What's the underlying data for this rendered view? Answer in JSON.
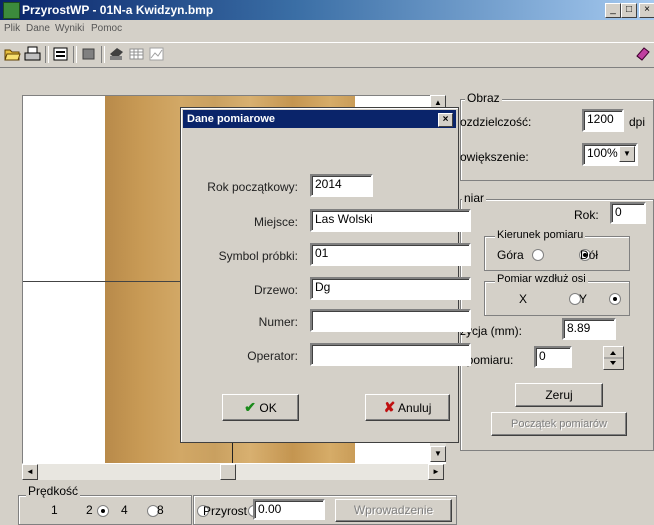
{
  "window": {
    "title": "PrzyrostWP - 01N-a Kwidzyn.bmp",
    "minimize": "_",
    "maximize": "□",
    "close": "×"
  },
  "menu": [
    "Plik",
    "Dane",
    "Wyniki",
    "Pomoc"
  ],
  "icons": [
    "open-folder-icon",
    "print-icon",
    "data-icon",
    "stop-icon",
    "printer-icon",
    "table-icon",
    "chart-icon",
    "eraser-icon"
  ],
  "image_panel": {
    "scroll_left": "◄",
    "scroll_right": "►",
    "scroll_up": "▲",
    "scroll_down": "▼"
  },
  "obraz": {
    "title": "Obraz",
    "resolution_label": "ozdzielczość:",
    "resolution_value": "1200",
    "resolution_unit": "dpi",
    "zoom_label": "owiększenie:",
    "zoom_value": "100%"
  },
  "pomiar": {
    "title": "niar",
    "year_label": "Rok:",
    "year_value": "0",
    "direction": {
      "title": "Kierunek pomiaru",
      "options": [
        "Góra",
        "Dół"
      ],
      "selected": "Dół"
    },
    "axis": {
      "title": "Pomiar wzdłuż osi",
      "options": [
        "X",
        "Y"
      ],
      "selected": "Y"
    },
    "position_label": "zycja (mm):",
    "position_value": "8.89",
    "point_label": "t pomiaru:",
    "point_value": "0",
    "reset_button": "Zeruj",
    "start_button": "Początek pomiarów"
  },
  "bottom": {
    "speed": {
      "title": "Prędkość",
      "options": [
        "1",
        "2",
        "4",
        "8"
      ],
      "selected": "1"
    },
    "increment_label": "Przyrost",
    "increment_value": "0.00",
    "enter_button": "Wprowadzenie"
  },
  "dialog": {
    "title": "Dane pomiarowe",
    "close": "×",
    "fields": [
      {
        "label": "Rok początkowy:",
        "value": "2014"
      },
      {
        "label": "Miejsce:",
        "value": "Las Wolski"
      },
      {
        "label": "Symbol próbki:",
        "value": "01"
      },
      {
        "label": "Drzewo:",
        "value": "Dg"
      },
      {
        "label": "Numer:",
        "value": ""
      },
      {
        "label": "Operator:",
        "value": ""
      }
    ],
    "ok_button": "OK",
    "ok_icon": "✔",
    "cancel_button": "Anuluj",
    "cancel_icon": "✘"
  }
}
